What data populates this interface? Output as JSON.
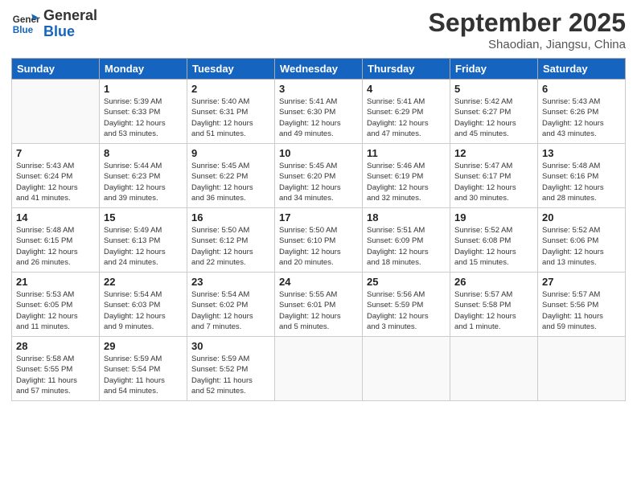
{
  "header": {
    "logo_general": "General",
    "logo_blue": "Blue",
    "month": "September 2025",
    "location": "Shaodian, Jiangsu, China"
  },
  "weekdays": [
    "Sunday",
    "Monday",
    "Tuesday",
    "Wednesday",
    "Thursday",
    "Friday",
    "Saturday"
  ],
  "weeks": [
    [
      {
        "day": "",
        "info": ""
      },
      {
        "day": "1",
        "info": "Sunrise: 5:39 AM\nSunset: 6:33 PM\nDaylight: 12 hours\nand 53 minutes."
      },
      {
        "day": "2",
        "info": "Sunrise: 5:40 AM\nSunset: 6:31 PM\nDaylight: 12 hours\nand 51 minutes."
      },
      {
        "day": "3",
        "info": "Sunrise: 5:41 AM\nSunset: 6:30 PM\nDaylight: 12 hours\nand 49 minutes."
      },
      {
        "day": "4",
        "info": "Sunrise: 5:41 AM\nSunset: 6:29 PM\nDaylight: 12 hours\nand 47 minutes."
      },
      {
        "day": "5",
        "info": "Sunrise: 5:42 AM\nSunset: 6:27 PM\nDaylight: 12 hours\nand 45 minutes."
      },
      {
        "day": "6",
        "info": "Sunrise: 5:43 AM\nSunset: 6:26 PM\nDaylight: 12 hours\nand 43 minutes."
      }
    ],
    [
      {
        "day": "7",
        "info": "Sunrise: 5:43 AM\nSunset: 6:24 PM\nDaylight: 12 hours\nand 41 minutes."
      },
      {
        "day": "8",
        "info": "Sunrise: 5:44 AM\nSunset: 6:23 PM\nDaylight: 12 hours\nand 39 minutes."
      },
      {
        "day": "9",
        "info": "Sunrise: 5:45 AM\nSunset: 6:22 PM\nDaylight: 12 hours\nand 36 minutes."
      },
      {
        "day": "10",
        "info": "Sunrise: 5:45 AM\nSunset: 6:20 PM\nDaylight: 12 hours\nand 34 minutes."
      },
      {
        "day": "11",
        "info": "Sunrise: 5:46 AM\nSunset: 6:19 PM\nDaylight: 12 hours\nand 32 minutes."
      },
      {
        "day": "12",
        "info": "Sunrise: 5:47 AM\nSunset: 6:17 PM\nDaylight: 12 hours\nand 30 minutes."
      },
      {
        "day": "13",
        "info": "Sunrise: 5:48 AM\nSunset: 6:16 PM\nDaylight: 12 hours\nand 28 minutes."
      }
    ],
    [
      {
        "day": "14",
        "info": "Sunrise: 5:48 AM\nSunset: 6:15 PM\nDaylight: 12 hours\nand 26 minutes."
      },
      {
        "day": "15",
        "info": "Sunrise: 5:49 AM\nSunset: 6:13 PM\nDaylight: 12 hours\nand 24 minutes."
      },
      {
        "day": "16",
        "info": "Sunrise: 5:50 AM\nSunset: 6:12 PM\nDaylight: 12 hours\nand 22 minutes."
      },
      {
        "day": "17",
        "info": "Sunrise: 5:50 AM\nSunset: 6:10 PM\nDaylight: 12 hours\nand 20 minutes."
      },
      {
        "day": "18",
        "info": "Sunrise: 5:51 AM\nSunset: 6:09 PM\nDaylight: 12 hours\nand 18 minutes."
      },
      {
        "day": "19",
        "info": "Sunrise: 5:52 AM\nSunset: 6:08 PM\nDaylight: 12 hours\nand 15 minutes."
      },
      {
        "day": "20",
        "info": "Sunrise: 5:52 AM\nSunset: 6:06 PM\nDaylight: 12 hours\nand 13 minutes."
      }
    ],
    [
      {
        "day": "21",
        "info": "Sunrise: 5:53 AM\nSunset: 6:05 PM\nDaylight: 12 hours\nand 11 minutes."
      },
      {
        "day": "22",
        "info": "Sunrise: 5:54 AM\nSunset: 6:03 PM\nDaylight: 12 hours\nand 9 minutes."
      },
      {
        "day": "23",
        "info": "Sunrise: 5:54 AM\nSunset: 6:02 PM\nDaylight: 12 hours\nand 7 minutes."
      },
      {
        "day": "24",
        "info": "Sunrise: 5:55 AM\nSunset: 6:01 PM\nDaylight: 12 hours\nand 5 minutes."
      },
      {
        "day": "25",
        "info": "Sunrise: 5:56 AM\nSunset: 5:59 PM\nDaylight: 12 hours\nand 3 minutes."
      },
      {
        "day": "26",
        "info": "Sunrise: 5:57 AM\nSunset: 5:58 PM\nDaylight: 12 hours\nand 1 minute."
      },
      {
        "day": "27",
        "info": "Sunrise: 5:57 AM\nSunset: 5:56 PM\nDaylight: 11 hours\nand 59 minutes."
      }
    ],
    [
      {
        "day": "28",
        "info": "Sunrise: 5:58 AM\nSunset: 5:55 PM\nDaylight: 11 hours\nand 57 minutes."
      },
      {
        "day": "29",
        "info": "Sunrise: 5:59 AM\nSunset: 5:54 PM\nDaylight: 11 hours\nand 54 minutes."
      },
      {
        "day": "30",
        "info": "Sunrise: 5:59 AM\nSunset: 5:52 PM\nDaylight: 11 hours\nand 52 minutes."
      },
      {
        "day": "",
        "info": ""
      },
      {
        "day": "",
        "info": ""
      },
      {
        "day": "",
        "info": ""
      },
      {
        "day": "",
        "info": ""
      }
    ]
  ]
}
